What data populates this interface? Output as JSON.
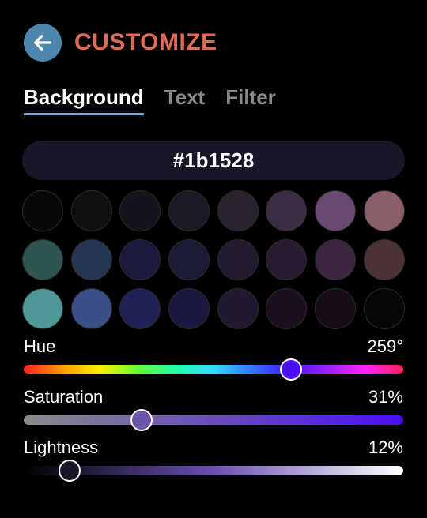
{
  "header": {
    "title": "CUSTOMIZE",
    "back_icon": "arrow-left-icon",
    "back_color": "#4f86ad",
    "title_color": "#e06a55"
  },
  "tabs": [
    {
      "label": "Background",
      "active": true
    },
    {
      "label": "Text",
      "active": false
    },
    {
      "label": "Filter",
      "active": false
    }
  ],
  "hex_value": "#1b1528",
  "swatches": [
    [
      "#070909",
      "#0e1012",
      "#13141c",
      "#1b1a26",
      "#2a222e",
      "#3b2e44",
      "#6a4a72",
      "#8c5e69"
    ],
    [
      "#2f5550",
      "#263551",
      "#1a1b3a",
      "#1c1b36",
      "#221b30",
      "#2a1c30",
      "#3c2640",
      "#4d3336"
    ],
    [
      "#4f9898",
      "#3a4f85",
      "#1f2254",
      "#1a1840",
      "#1f1830",
      "#1b1020",
      "#150c14",
      "#080608"
    ]
  ],
  "sliders": {
    "hue": {
      "label": "Hue",
      "value_text": "259°",
      "fraction": 0.705,
      "thumb_color": "#4a0ff2"
    },
    "saturation": {
      "label": "Saturation",
      "value_text": "31%",
      "fraction": 0.31,
      "thumb_color": "#6b55a8"
    },
    "lightness": {
      "label": "Lightness",
      "value_text": "12%",
      "fraction": 0.12,
      "thumb_color": "#1b1528"
    }
  }
}
